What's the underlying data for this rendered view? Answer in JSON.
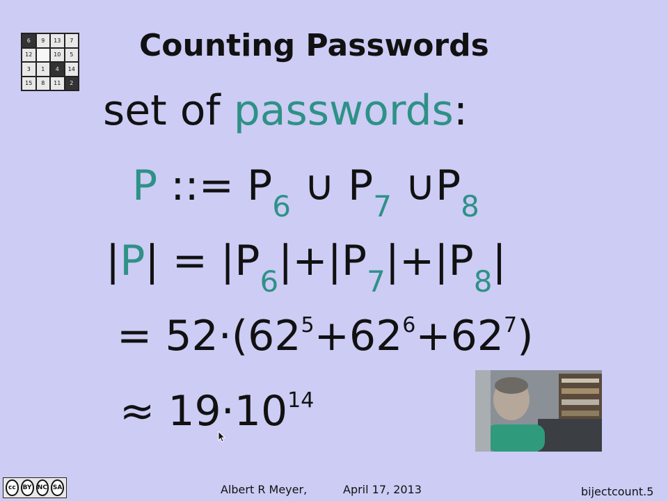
{
  "logo": {
    "tiles": [
      "6",
      "9",
      "13",
      "7",
      "12",
      "",
      "10",
      "5",
      "3",
      "1",
      "4",
      "14",
      "15",
      "8",
      "11",
      "2"
    ]
  },
  "slide": {
    "title": "Counting Passwords",
    "line1": {
      "prefix": "set of ",
      "highlight": "passwords",
      "suffix": ":"
    },
    "line2": {
      "lhs": "P",
      "op": " ::= ",
      "t1": "P",
      "s1": "6",
      "u1": " ∪ ",
      "t2": "P",
      "s2": "7",
      "u2": " ∪",
      "t3": "P",
      "s3": "8"
    },
    "line3": {
      "bar_open": "|",
      "p": "P",
      "bar_close_eq": "| = |P",
      "s1": "6",
      "mid1": "|+|P",
      "s2": "7",
      "mid2": "|+|P",
      "s3": "8",
      "end": "|"
    },
    "line4": {
      "a": "= 52·(62",
      "e1": "5",
      "b": "+62",
      "e2": "6",
      "c": "+62",
      "e3": "7",
      "d": ")"
    },
    "line5": {
      "a": "≈ 19·10",
      "e": "14"
    }
  },
  "footer": {
    "author": "Albert R Meyer,",
    "date": "April 17, 2013",
    "slide_id": "bijectcount.5",
    "license_marks": [
      "cc",
      "BY",
      "NC",
      "SA"
    ]
  },
  "colors": {
    "background": "#ccccf5",
    "accent": "#2e9186"
  }
}
